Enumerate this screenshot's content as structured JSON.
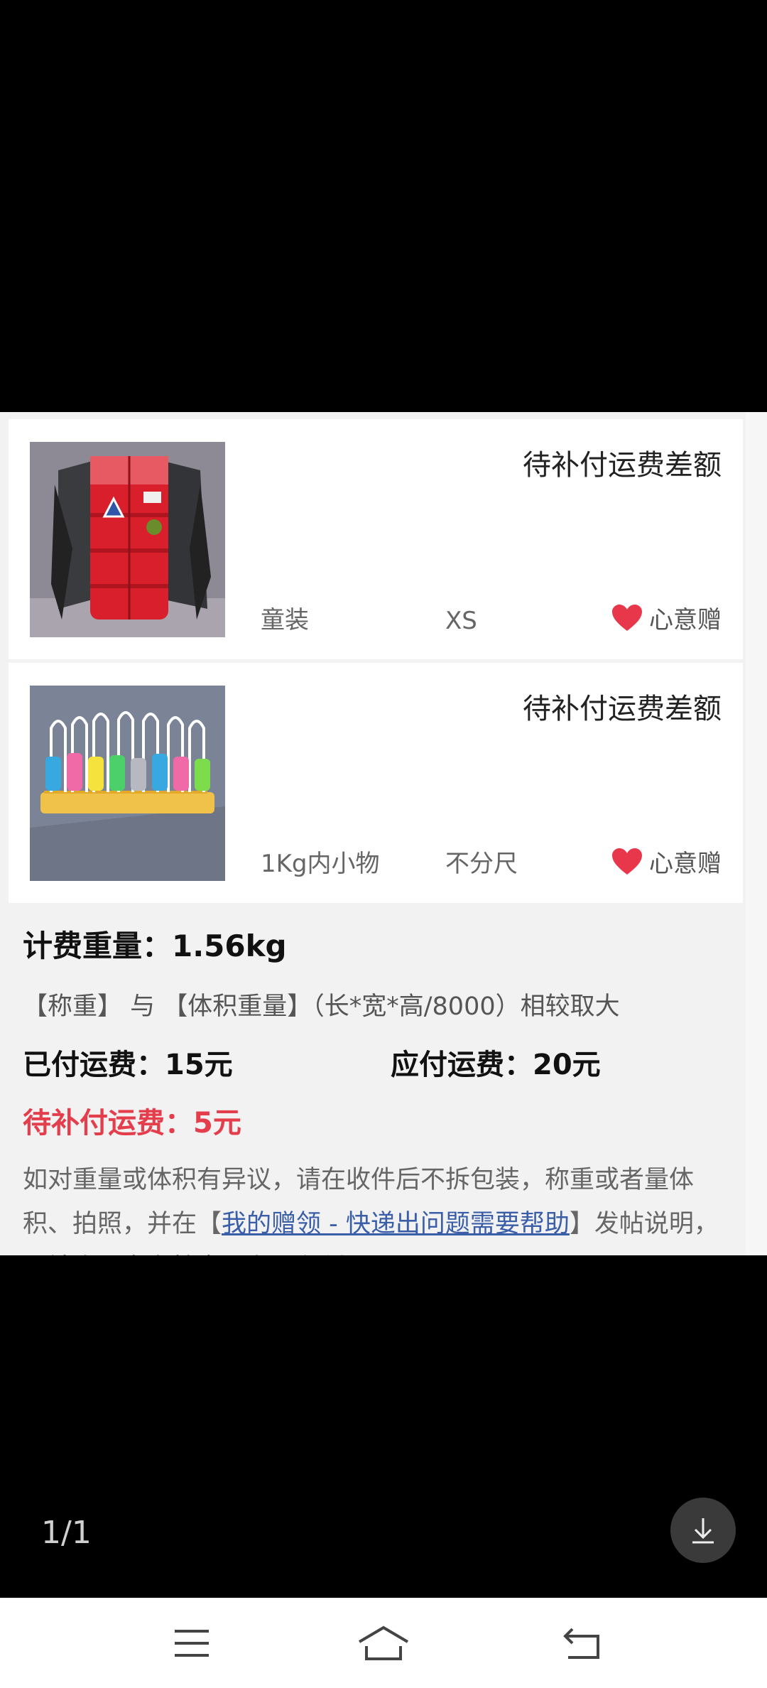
{
  "items": [
    {
      "status": "待补付运费差额",
      "category": "童装",
      "size": "XS",
      "badge": "心意赠",
      "image": "red-kids-jacket-photo"
    },
    {
      "status": "待补付运费差额",
      "category": "1Kg内小物",
      "size": "不分尺",
      "badge": "心意赠",
      "image": "abacus-toy-photo"
    }
  ],
  "summary": {
    "charge_weight": "计费重量：1.56kg",
    "rule": "【称重】 与 【体积重量】（长*宽*高/8000）相较取大",
    "paid": "已付运费：15元",
    "due": "应付运费：20元",
    "owed": "待补付运费：5元",
    "notice_pre": "如对重量或体积有异议，请在收件后不拆包装，称重或者量体积、拍照，并在【",
    "notice_link": "我的赠领 - 快递出问题需要帮助",
    "notice_post": "】发帖说明，公社会与京东核实，有误必纠。"
  },
  "viewer": {
    "page_indicator": "1/1"
  },
  "colors": {
    "accent_red": "#e43d4c",
    "link_blue": "#3a5ea8",
    "heart_red": "#e8364a"
  },
  "icons": [
    "heart-icon",
    "download-icon",
    "menu-icon",
    "home-icon",
    "back-icon"
  ]
}
